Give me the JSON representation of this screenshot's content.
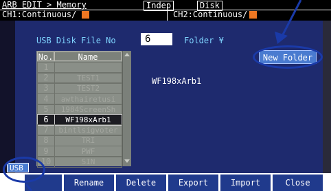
{
  "header": {
    "breadcrumb": "ARB EDIT > Memory",
    "mode": "Indep",
    "storage": "Disk",
    "ch1": "CH1:Continuous/",
    "ch2": "CH2:Continuous/"
  },
  "main": {
    "file_no_label": "USB Disk File No",
    "file_no_value": "6",
    "folder_label": "Folder ¥",
    "new_folder": "New Folder",
    "preview_name": "WF198xArb1",
    "list_headers": {
      "no": "No.",
      "name": "Name"
    },
    "files": [
      {
        "no": "1",
        "name": ""
      },
      {
        "no": "2",
        "name": "TEST1"
      },
      {
        "no": "3",
        "name": "TEST2"
      },
      {
        "no": "4",
        "name": "awthairetusi"
      },
      {
        "no": "5",
        "name": "1984ScreenSh"
      },
      {
        "no": "6",
        "name": "WF198xArb1"
      },
      {
        "no": "7",
        "name": "bintlsigvoter"
      },
      {
        "no": "8",
        "name": "TRI"
      },
      {
        "no": "9",
        "name": "PWF"
      },
      {
        "no": "10",
        "name": "SIN"
      }
    ],
    "selected_index": 5
  },
  "side": {
    "usb_label": "USB"
  },
  "softkeys": [
    "Rename",
    "Delete",
    "Export",
    "Import",
    "Close"
  ],
  "colors": {
    "accent_orange": "#ee7722",
    "panel_blue": "#1e2a6e",
    "softkey_blue": "#203a8c",
    "annotation_blue": "#1a3aa8"
  }
}
